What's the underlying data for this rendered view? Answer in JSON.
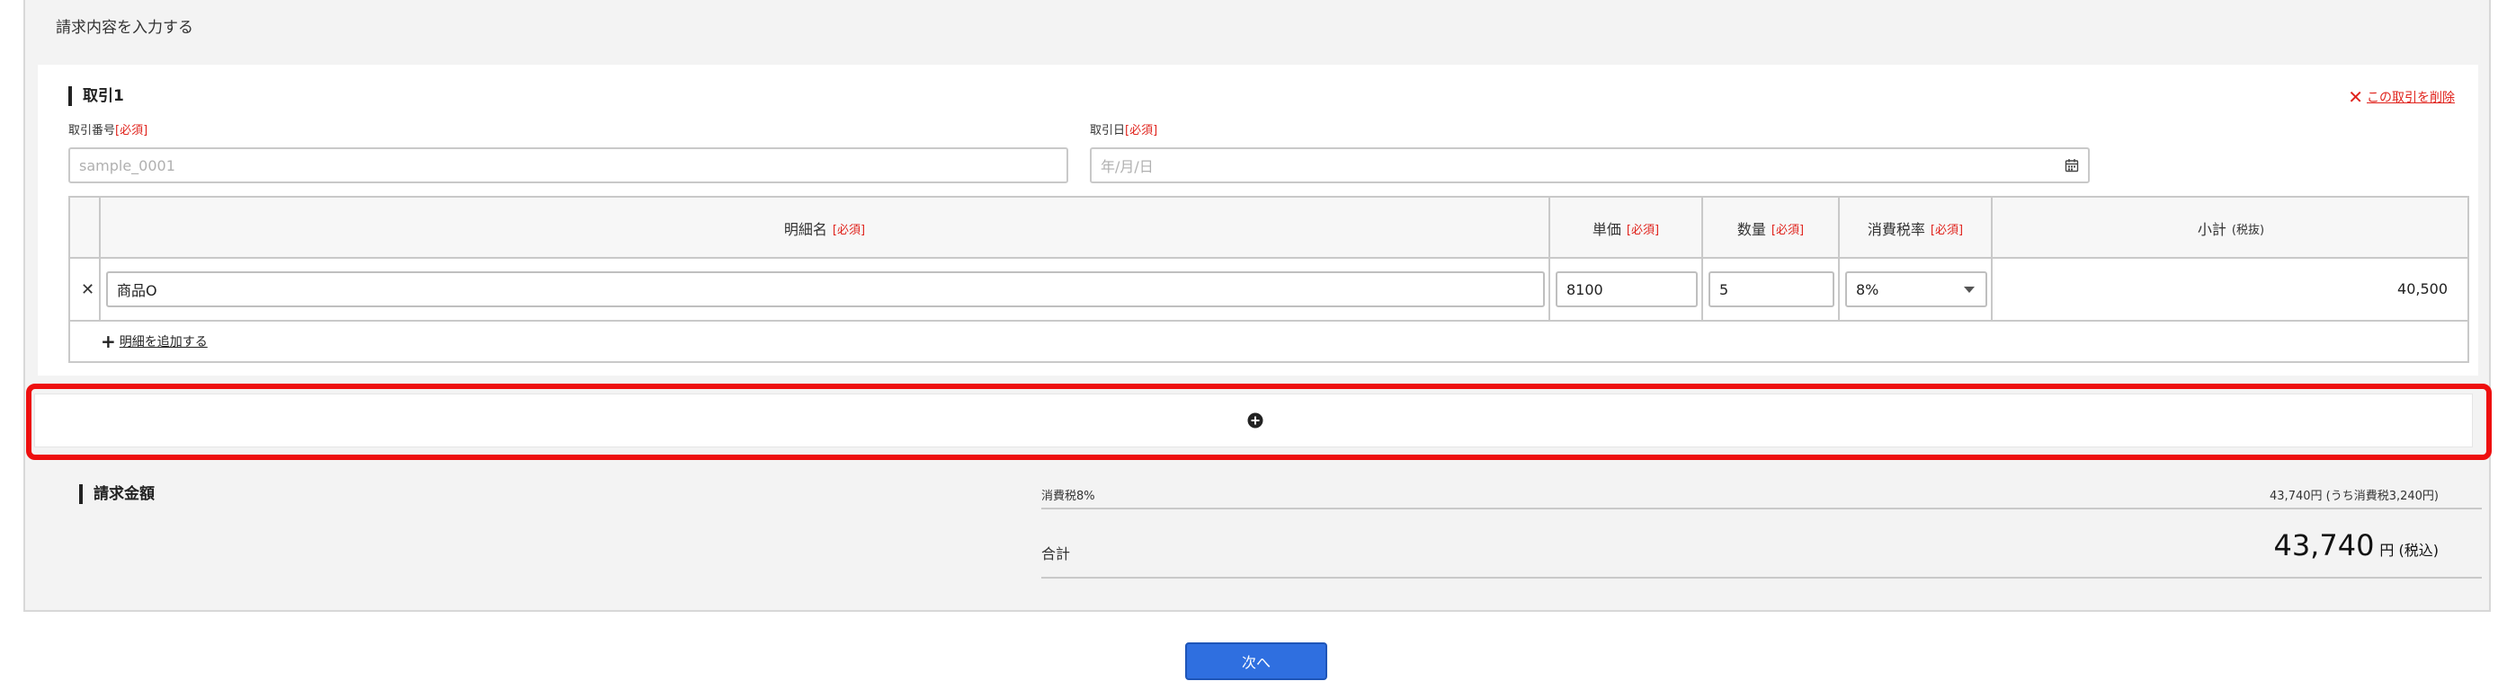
{
  "section_header": {
    "title": "請求内容を入力する"
  },
  "transaction": {
    "title": "取引1",
    "delete_label": "この取引を削除",
    "number_label": "取引番号",
    "date_label": "取引日",
    "required": "[必須]",
    "number_placeholder": "sample_0001",
    "date_placeholder": "年/月/日"
  },
  "items_table": {
    "headers": {
      "name": "明細名",
      "unit_price": "単価",
      "quantity": "数量",
      "tax_rate": "消費税率",
      "subtotal": "小計",
      "subtotal_note": "(税抜)"
    },
    "rows": [
      {
        "name": "商品O",
        "unit_price": "8100",
        "quantity": "5",
        "tax_rate": "8%",
        "subtotal": "40,500"
      }
    ],
    "add_label": "明細を追加する"
  },
  "billing": {
    "title": "請求金額",
    "tax_label": "消費税8%",
    "tax_value": "43,740円 (うち消費税3,240円)",
    "total_label": "合計",
    "total_value": "43,740",
    "total_unit": "円 (税込)"
  },
  "next_button": "次へ",
  "colors": {
    "accent": "#2f6fe0",
    "required": "#e0231c",
    "highlight": "#ee0f0f"
  }
}
